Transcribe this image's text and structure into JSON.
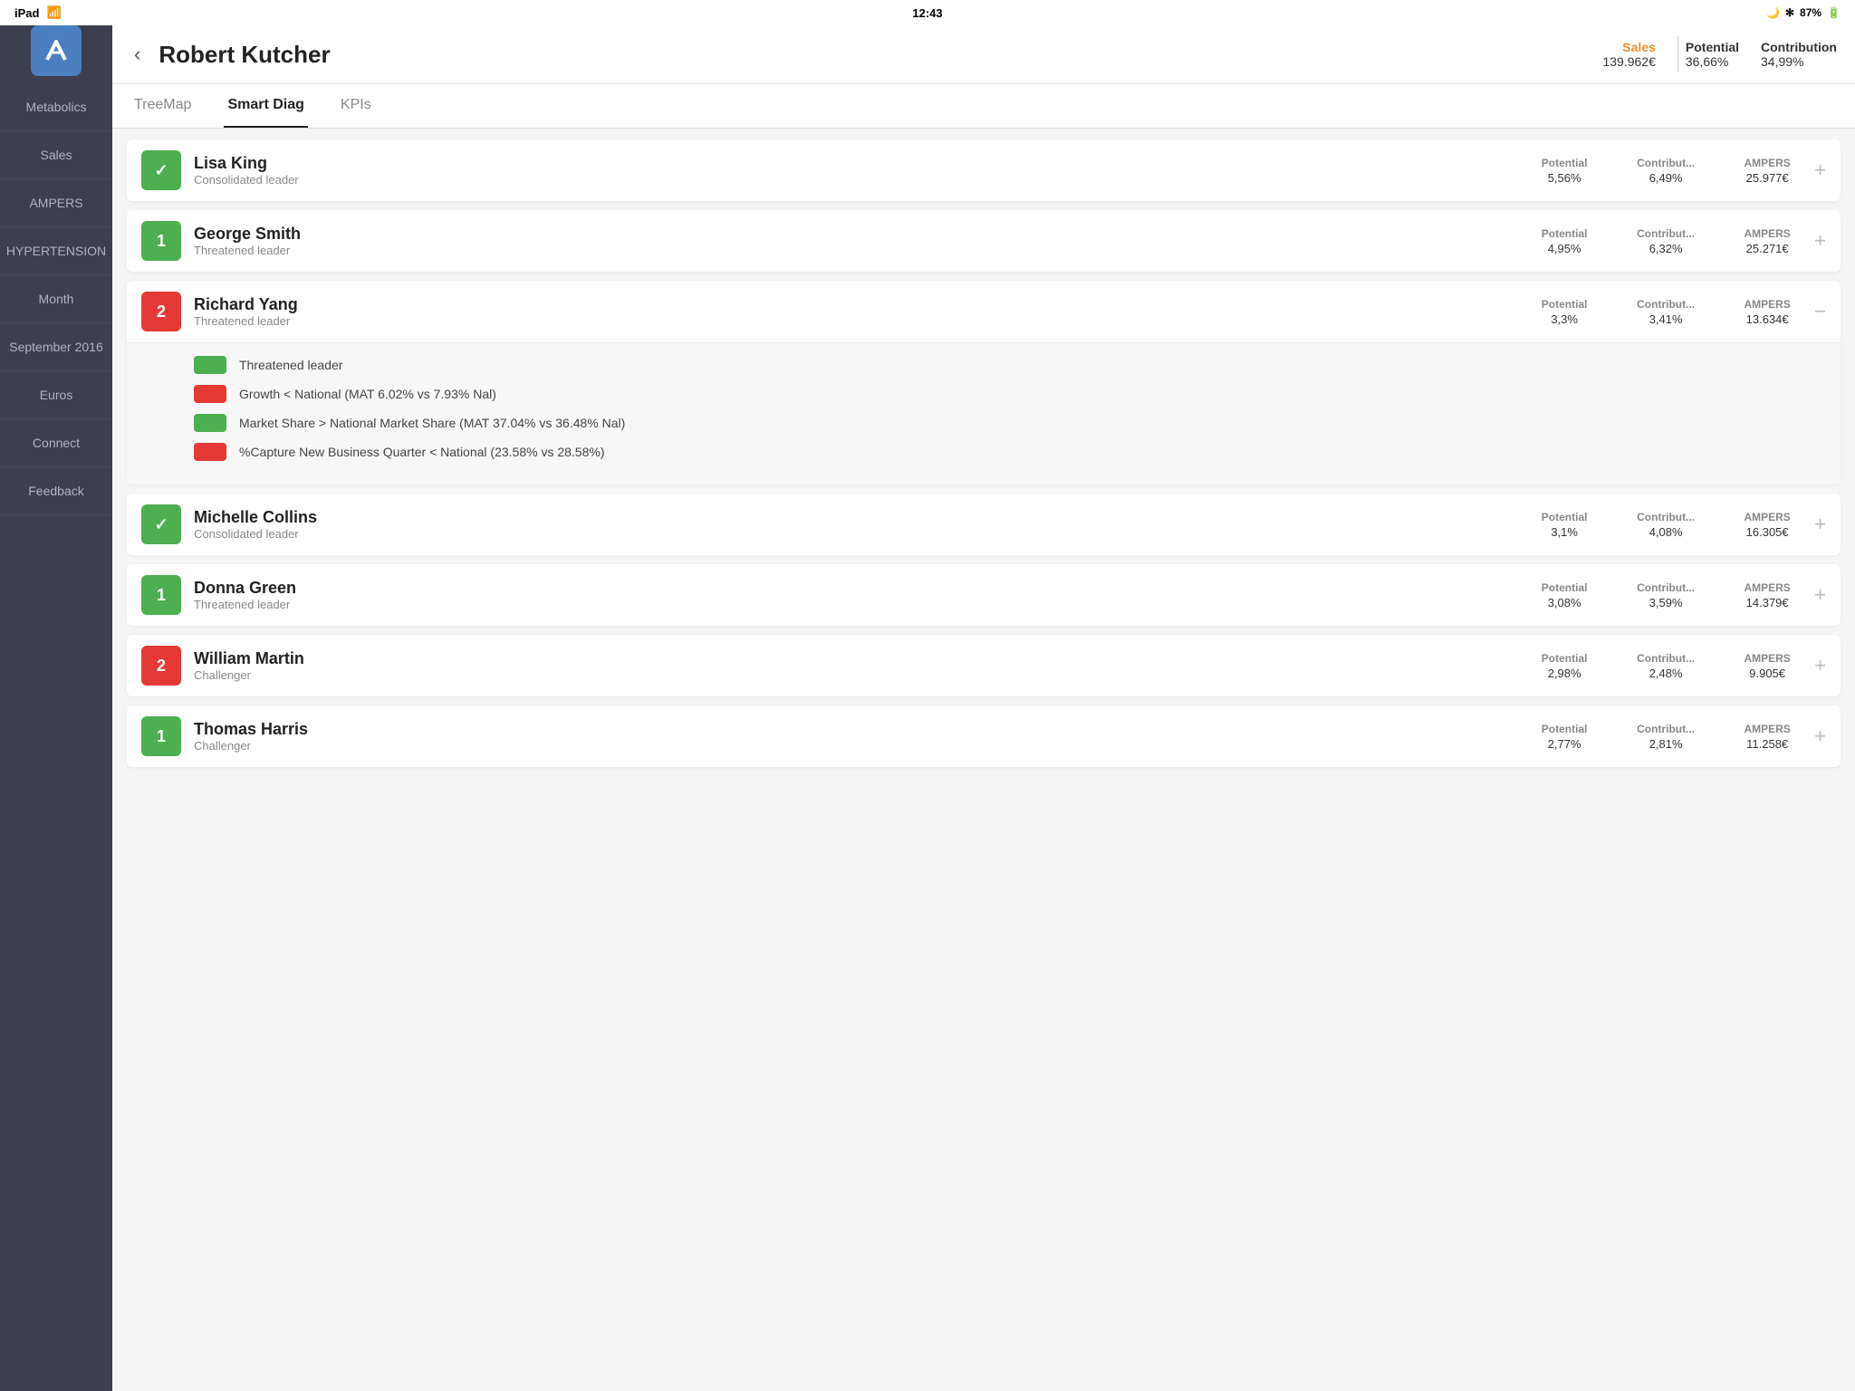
{
  "statusBar": {
    "left": "iPad",
    "time": "12:43",
    "right_moon": "🌙",
    "right_bluetooth": "✻",
    "right_battery": "87%"
  },
  "sidebar": {
    "logo_icon": "K",
    "items": [
      {
        "id": "metabolics",
        "label": "Metabolics"
      },
      {
        "id": "sales",
        "label": "Sales"
      },
      {
        "id": "ampers",
        "label": "AMPERS"
      },
      {
        "id": "hypertension",
        "label": "HYPERTENSION"
      },
      {
        "id": "month",
        "label": "Month"
      },
      {
        "id": "september2016",
        "label": "September 2016"
      },
      {
        "id": "euros",
        "label": "Euros"
      },
      {
        "id": "connect",
        "label": "Connect"
      },
      {
        "id": "feedback",
        "label": "Feedback"
      }
    ]
  },
  "header": {
    "back_label": "‹",
    "title": "Robert Kutcher",
    "sales_label": "Sales",
    "sales_value": "139.962€",
    "potential_label": "Potential",
    "contribution_label": "Contribution",
    "potential_value": "36,66%",
    "contribution_value": "34,99%"
  },
  "tabs": [
    {
      "id": "treemap",
      "label": "TreeMap",
      "active": false
    },
    {
      "id": "smartdiag",
      "label": "Smart Diag",
      "active": true
    },
    {
      "id": "kpis",
      "label": "KPIs",
      "active": false
    }
  ],
  "persons": [
    {
      "id": "lisa-king",
      "badge_type": "check",
      "badge_color": "green",
      "name": "Lisa King",
      "role": "Consolidated leader",
      "potential": "5,56%",
      "contribution": "6,49%",
      "ampers": "25.977€",
      "expanded": false,
      "expand_icon": "+"
    },
    {
      "id": "george-smith",
      "badge_type": "number",
      "badge_number": "1",
      "badge_color": "green",
      "name": "George Smith",
      "role": "Threatened leader",
      "potential": "4,95%",
      "contribution": "6,32%",
      "ampers": "25.271€",
      "expanded": false,
      "expand_icon": "+"
    },
    {
      "id": "richard-yang",
      "badge_type": "number",
      "badge_number": "2",
      "badge_color": "red",
      "name": "Richard Yang",
      "role": "Threatened leader",
      "potential": "3,3%",
      "contribution": "3,41%",
      "ampers": "13.634€",
      "expanded": true,
      "expand_icon": "−",
      "details": [
        {
          "color": "green",
          "text": "Threatened leader"
        },
        {
          "color": "red",
          "text": "Growth < National (MAT 6.02% vs 7.93% Nal)"
        },
        {
          "color": "green",
          "text": "Market Share > National Market Share (MAT 37.04% vs 36.48% Nal)"
        },
        {
          "color": "red",
          "text": "%Capture New Business Quarter < National (23.58% vs 28.58%)"
        }
      ]
    },
    {
      "id": "michelle-collins",
      "badge_type": "check",
      "badge_color": "green",
      "name": "Michelle Collins",
      "role": "Consolidated leader",
      "potential": "3,1%",
      "contribution": "4,08%",
      "ampers": "16.305€",
      "expanded": false,
      "expand_icon": "+"
    },
    {
      "id": "donna-green",
      "badge_type": "number",
      "badge_number": "1",
      "badge_color": "green",
      "name": "Donna Green",
      "role": "Threatened leader",
      "potential": "3,08%",
      "contribution": "3,59%",
      "ampers": "14.379€",
      "expanded": false,
      "expand_icon": "+"
    },
    {
      "id": "william-martin",
      "badge_type": "number",
      "badge_number": "2",
      "badge_color": "red",
      "name": "William Martin",
      "role": "Challenger",
      "potential": "2,98%",
      "contribution": "2,48%",
      "ampers": "9.905€",
      "expanded": false,
      "expand_icon": "+"
    },
    {
      "id": "thomas-harris",
      "badge_type": "number",
      "badge_number": "1",
      "badge_color": "green",
      "name": "Thomas Harris",
      "role": "Challenger",
      "potential": "2,77%",
      "contribution": "2,81%",
      "ampers": "11.258€",
      "expanded": false,
      "expand_icon": "+"
    }
  ],
  "column_labels": {
    "potential": "Potential",
    "contribution": "Contribut...",
    "ampers": "AMPERS"
  }
}
